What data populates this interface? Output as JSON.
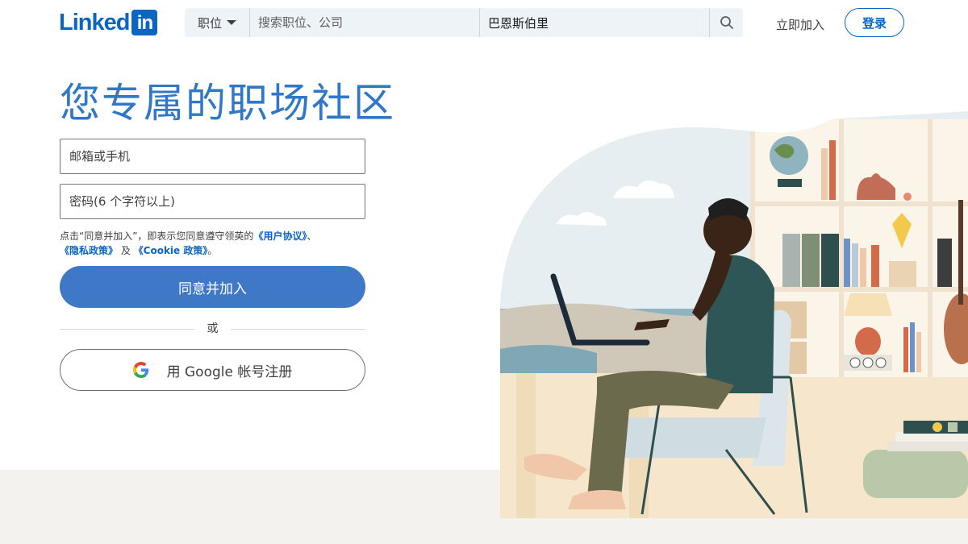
{
  "header": {
    "logo_text": "Linked",
    "logo_box": "in",
    "search": {
      "category": "职位",
      "keyword_placeholder": "搜索职位、公司",
      "location_value": "巴恩斯伯里"
    },
    "join_label": "立即加入",
    "signin_label": "登录"
  },
  "hero": {
    "headline": "您专属的职场社区"
  },
  "form": {
    "email_placeholder": "邮箱或手机",
    "password_placeholder": "密码(6 个字符以上)",
    "terms_prefix": "点击“同意并加入”，即表示您同意遵守领英的",
    "terms_user_agreement": "《用户协议》",
    "terms_sep": "、",
    "terms_privacy": "《隐私政策》",
    "terms_and": " 及 ",
    "terms_cookie": "《Cookie 政策》",
    "terms_end": "。",
    "agree_button": "同意并加入",
    "or_text": "或",
    "google_button": "用 Google 帐号注册"
  },
  "colors": {
    "brand": "#0a66c2",
    "headline": "#2e78c7",
    "primary_button": "#3e78c6",
    "search_bg": "#eef3f8",
    "bottom_band": "#f4f2ee"
  },
  "icons": {
    "search": "search-icon",
    "caret": "chevron-down-icon",
    "google": "google-icon"
  }
}
